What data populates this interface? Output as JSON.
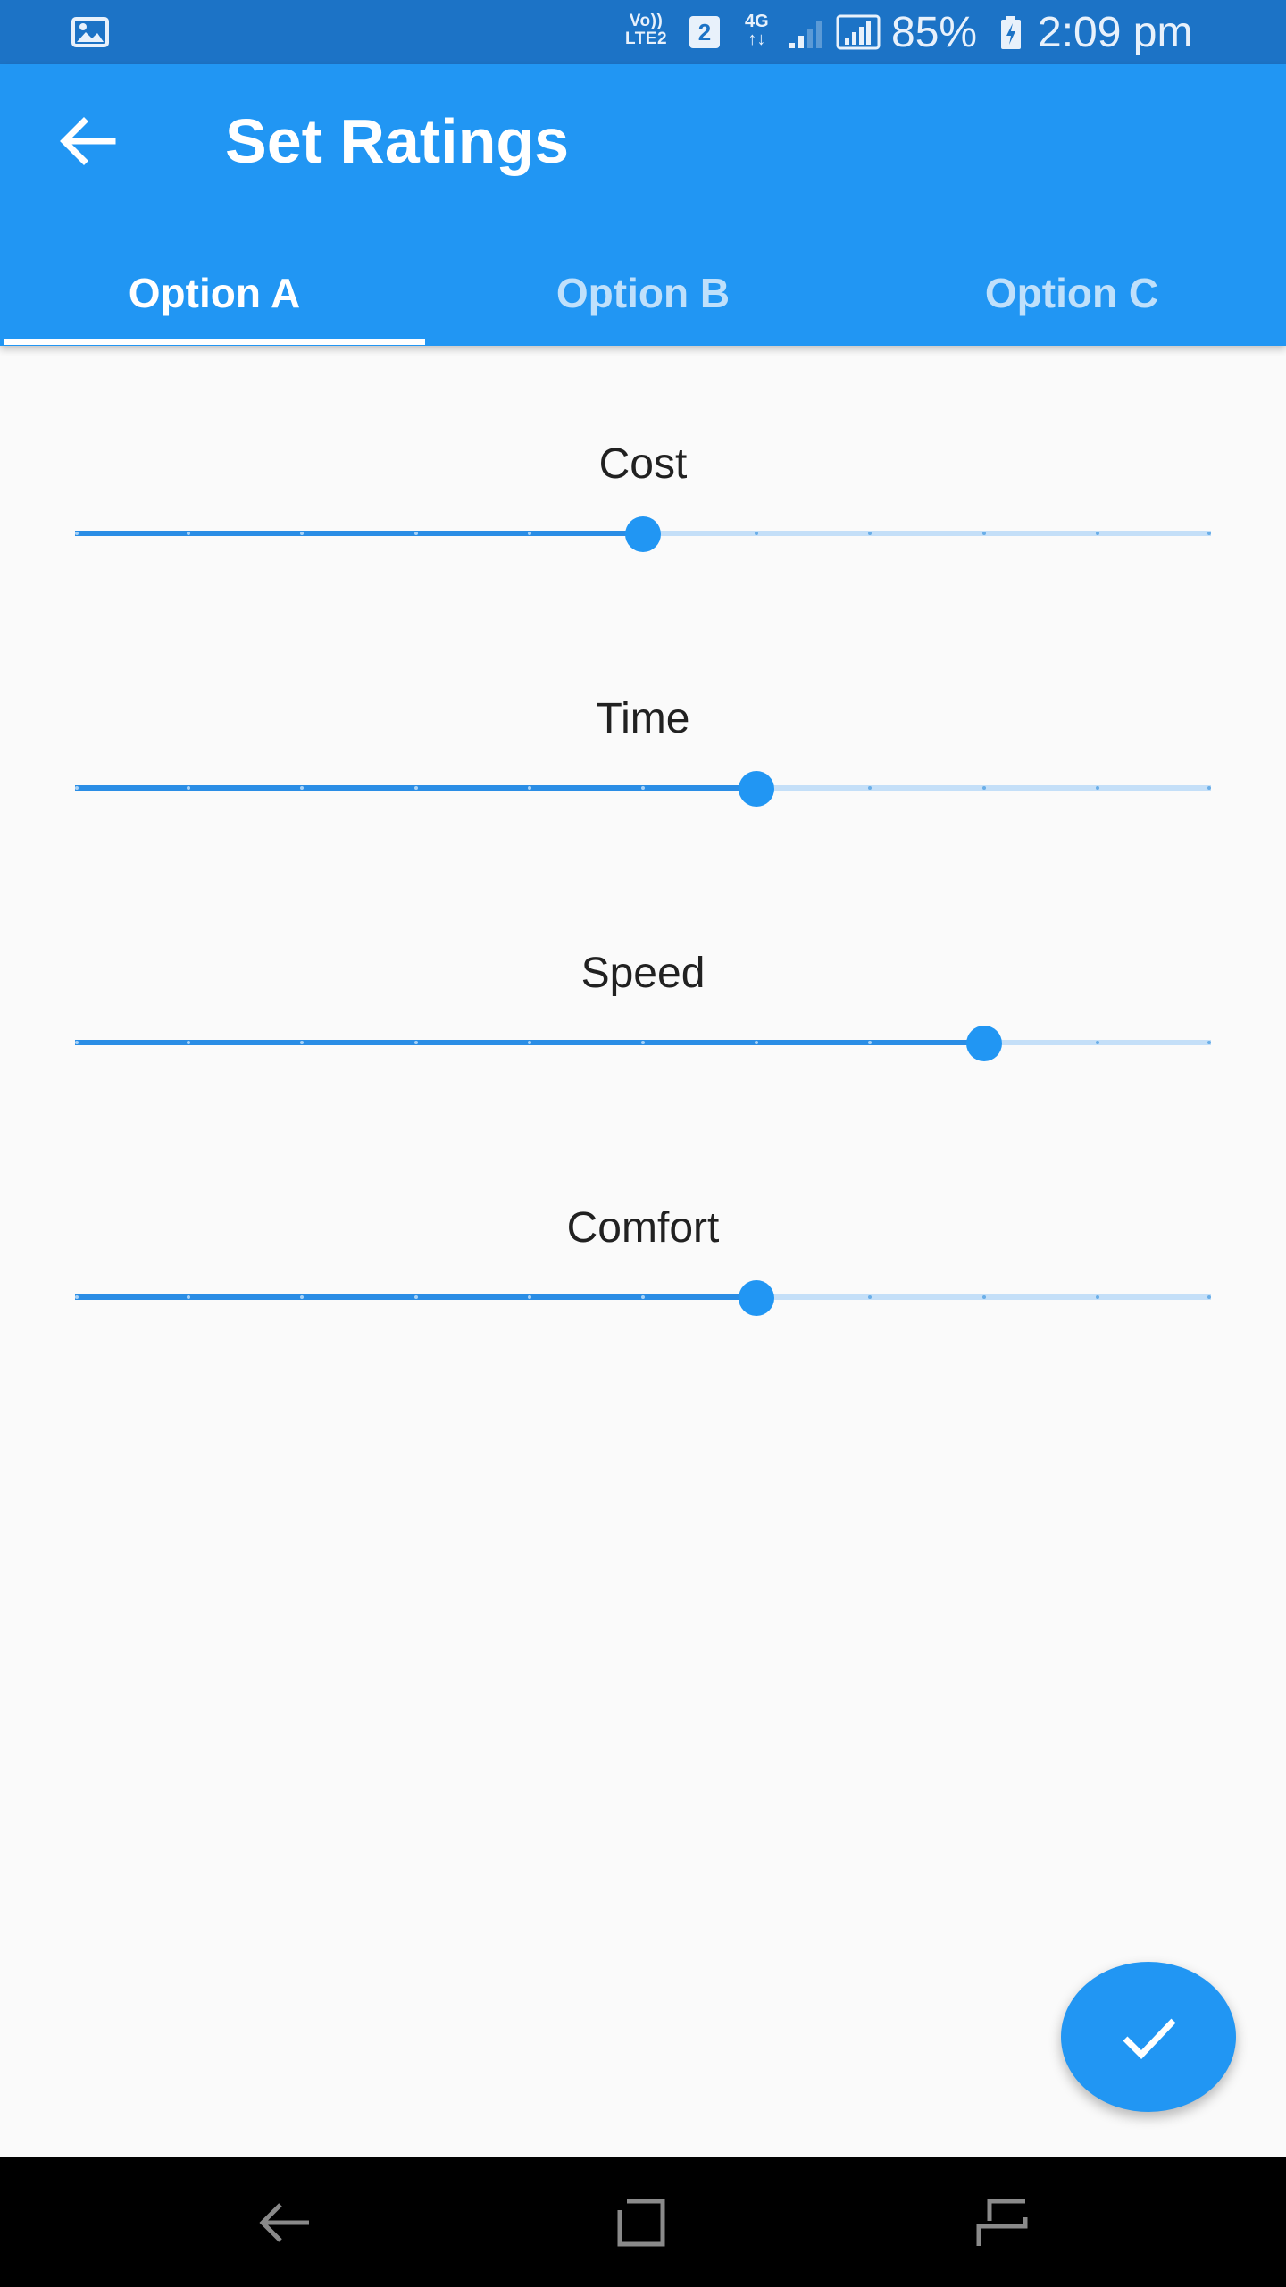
{
  "status_bar": {
    "volte_line1": "Vo))",
    "volte_line2": "LTE2",
    "sim": "2",
    "network": "4G",
    "network_arrows": "↑↓",
    "battery_percent": "85%",
    "time": "2:09 pm",
    "icons": [
      "gallery-icon",
      "signal-icon",
      "signal-icon",
      "battery-charging-icon"
    ]
  },
  "appbar": {
    "title": "Set Ratings",
    "back_icon": "arrow-back-icon",
    "tabs": [
      {
        "label": "Option A",
        "active": true
      },
      {
        "label": "Option B",
        "active": false
      },
      {
        "label": "Option C",
        "active": false
      }
    ]
  },
  "ratings": [
    {
      "label": "Cost",
      "value": 5,
      "max": 10
    },
    {
      "label": "Time",
      "value": 6,
      "max": 10
    },
    {
      "label": "Speed",
      "value": 8,
      "max": 10
    },
    {
      "label": "Comfort",
      "value": 6,
      "max": 10
    }
  ],
  "fab": {
    "icon": "check-icon"
  },
  "nav_bar": {
    "icons": [
      "back-icon",
      "overview-icon",
      "recents-icon"
    ]
  },
  "colors": {
    "primary": "#2196f3",
    "status_bar": "#1c73c6",
    "slider_active": "#2a8de5",
    "slider_inactive": "#c4dff8",
    "inactive_tab_text": "#bfe0fb"
  }
}
